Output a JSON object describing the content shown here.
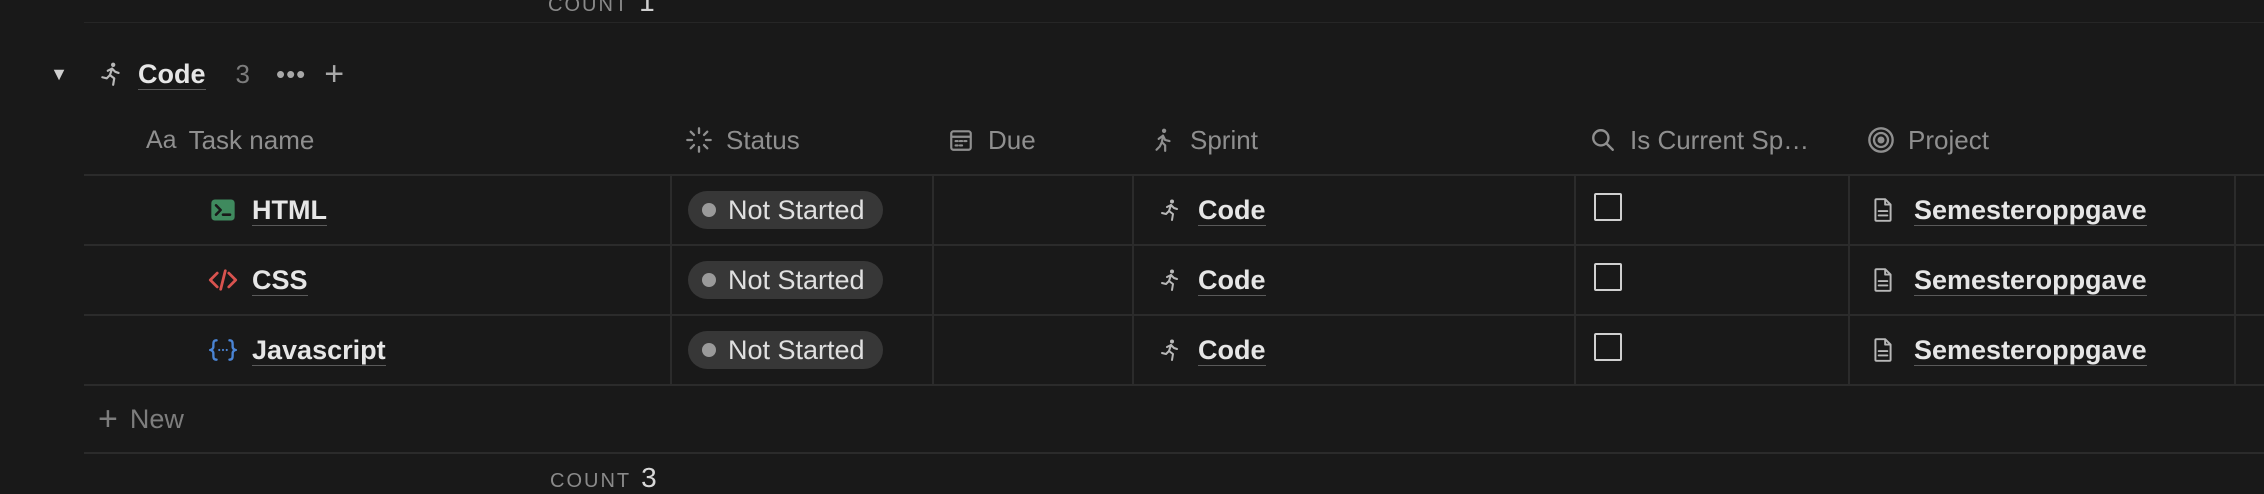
{
  "top_partial": {
    "label": "COUNT",
    "value": "1"
  },
  "group": {
    "title": "Code",
    "count": "3",
    "more_label": "•••",
    "add_label": "+"
  },
  "columns": {
    "task_name": {
      "prefix": "Aa",
      "label": "Task name"
    },
    "status": {
      "label": "Status",
      "icon": "status-icon"
    },
    "due": {
      "label": "Due",
      "icon": "calendar-icon"
    },
    "sprint": {
      "label": "Sprint",
      "icon": "runner-icon"
    },
    "current_sprint": {
      "label": "Is Current Sp…",
      "icon": "search-icon"
    },
    "project": {
      "label": "Project",
      "icon": "target-icon"
    }
  },
  "rows": [
    {
      "task": "HTML",
      "task_icon": "terminal-icon",
      "status": "Not Started",
      "due": "",
      "sprint": "Code",
      "is_current": false,
      "project": "Semesteroppgave"
    },
    {
      "task": "CSS",
      "task_icon": "code-brackets-icon",
      "status": "Not Started",
      "due": "",
      "sprint": "Code",
      "is_current": false,
      "project": "Semesteroppgave"
    },
    {
      "task": "Javascript",
      "task_icon": "curly-braces-icon",
      "status": "Not Started",
      "due": "",
      "sprint": "Code",
      "is_current": false,
      "project": "Semesteroppgave"
    }
  ],
  "new_row": {
    "label": "New"
  },
  "footer": {
    "label": "COUNT",
    "value": "3"
  },
  "colors": {
    "background": "#191919",
    "pill": "#373737",
    "terminal": "#3f8a5e",
    "css": "#d9534f",
    "js": "#4a84d4"
  }
}
